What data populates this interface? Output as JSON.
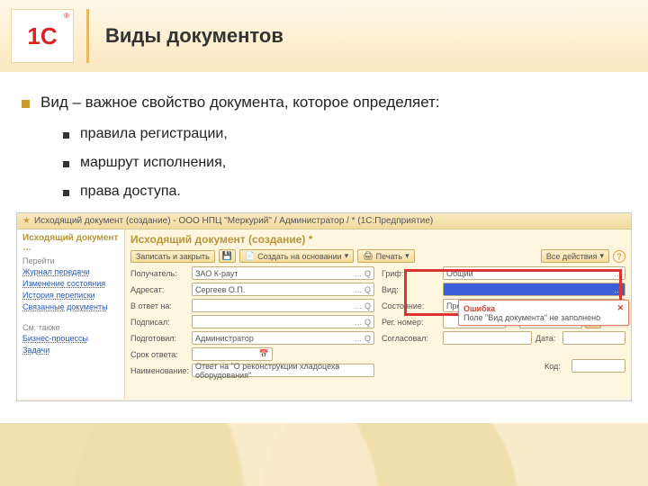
{
  "slide": {
    "title": "Виды документов",
    "bullet": "Вид – важное свойство документа, которое определяет:",
    "subs": [
      "правила регистрации,",
      "маршрут исполнения,",
      "права доступа."
    ]
  },
  "window": {
    "title": "Исходящий документ (создание) - ООО НПЦ \"Меркурий\" / Администратор / * (1С:Предприятие)"
  },
  "nav": {
    "header": "Исходящий документ …",
    "go": "Перейти",
    "links": [
      "Журнал передачи",
      "Изменение состояния",
      "История переписки",
      "Связанные документы"
    ],
    "also": "См. также",
    "links2": [
      "Бизнес-процессы",
      "Задачи"
    ]
  },
  "form": {
    "title": "Исходящий документ (создание) *",
    "save_close": "Записать и закрыть",
    "create_based": "Создать на основании",
    "print": "Печать",
    "all_actions": "Все действия",
    "labels": {
      "recipient": "Получатель:",
      "addressee": "Адресат:",
      "in_reply": "В ответ на:",
      "signed": "Подписал:",
      "prepared": "Подготовил:",
      "due": "Срок ответа:",
      "name": "Наименование:",
      "stamp": "Гриф:",
      "kind": "Вид:",
      "state": "Состояние:",
      "reg": "Рег. номер:",
      "approved": "Согласовал:",
      "date": "Дата:",
      "code": "Код:"
    },
    "values": {
      "recipient": "ЗАО К-раут",
      "addressee": "Сергеев О.П.",
      "in_reply": "",
      "signed": "",
      "prepared": "Администратор",
      "due": "",
      "name": "Ответ на \"О реконструкции хладоцеха оборудования\"",
      "stamp": "Общий",
      "kind": "",
      "state": "Проект",
      "reg": "",
      "approved": "",
      "date": "",
      "code": ""
    }
  },
  "error": {
    "title": "Ошибка",
    "msg": "Поле \"Вид документа\" не заполнено"
  }
}
